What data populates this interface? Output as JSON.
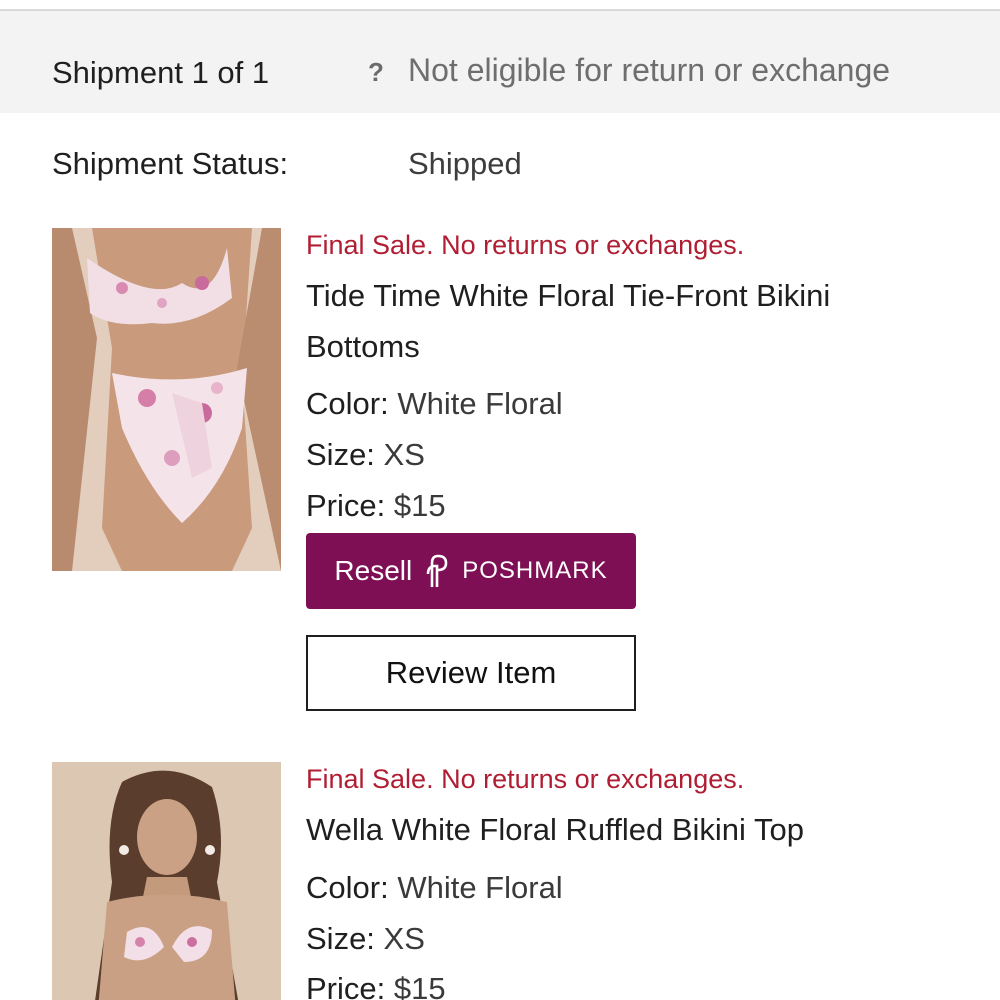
{
  "shipment": {
    "title": "Shipment 1 of 1",
    "help_glyph": "?",
    "return_note": "Not eligible for return or exchange",
    "status_label": "Shipment Status:",
    "status_value": "Shipped"
  },
  "labels": {
    "color": "Color:",
    "size": "Size:",
    "price": "Price:"
  },
  "items": [
    {
      "notice": "Final Sale. No returns or exchanges.",
      "name": "Tide Time White Floral Tie-Front Bikini Bottoms",
      "color": "White Floral",
      "size": "XS",
      "price": "$15",
      "resell_label": "Resell",
      "resell_brand": "POSHMARK",
      "review_label": "Review Item",
      "image_icon": "product-photo-bikini-bottoms"
    },
    {
      "notice": "Final Sale. No returns or exchanges.",
      "name": "Wella White Floral Ruffled Bikini Top",
      "color": "White Floral",
      "size": "XS",
      "price": "$15",
      "image_icon": "product-photo-bikini-top"
    }
  ],
  "colors": {
    "final_sale_red": "#b01e33",
    "poshmark_magenta": "#7f0f55",
    "header_bg": "#f3f3f3"
  }
}
